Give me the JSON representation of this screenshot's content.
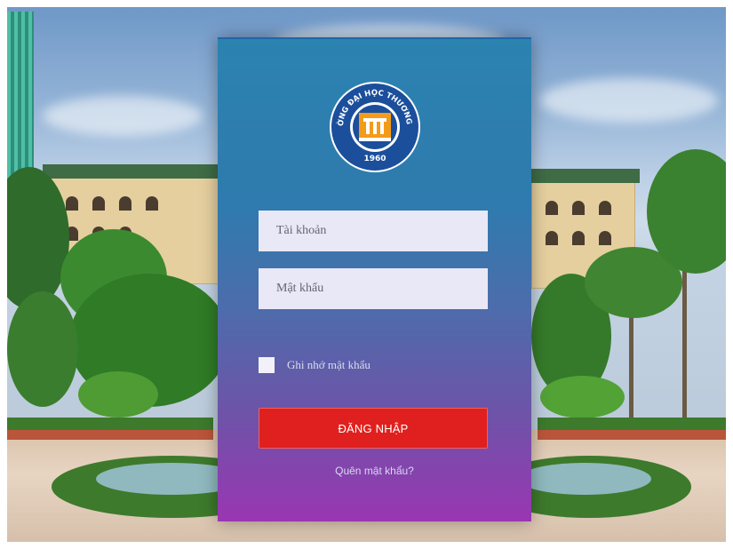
{
  "logo": {
    "arc_text": "TRƯỜNG ĐẠI HỌC THƯƠNG MẠI",
    "year": "1960",
    "icon": "university-emblem"
  },
  "form": {
    "username_placeholder": "Tài khoản",
    "password_placeholder": "Mật khẩu",
    "remember_label": "Ghi nhớ mật khẩu",
    "remember_checked": false,
    "login_label": "ĐĂNG NHẬP",
    "forgot_label": "Quên mật khẩu?"
  },
  "colors": {
    "card_top": "#2b83b0",
    "card_bottom": "#9a36b2",
    "login_button": "#e0201e",
    "input_bg": "#e9e8f6"
  }
}
